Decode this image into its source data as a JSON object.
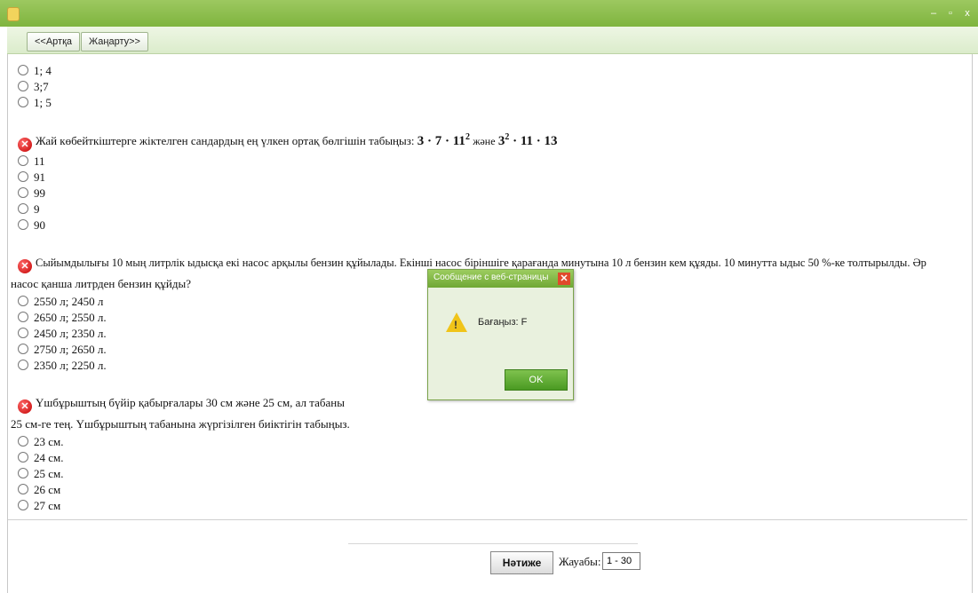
{
  "window": {
    "minimize": "–",
    "maximize": "▫",
    "close": "x"
  },
  "toolbar": {
    "back_label": "<<Артқа",
    "refresh_label": "Жаңарту>>"
  },
  "question0": {
    "options": [
      "1; 4",
      "3;7",
      "1; 5"
    ]
  },
  "question1": {
    "text": "Жай көбейткіштерге жіктелген сандардың ең үлкен ортақ бөлгішін табыңыз:",
    "formula1": "3 · 7 · 11",
    "formula1_exp": "2",
    "connector": "және",
    "formula2_base": "3",
    "formula2_exp": "2",
    "formula2_rest": " · 11 · 13",
    "options": [
      "11",
      "91",
      "99",
      "9",
      "90"
    ]
  },
  "question2": {
    "line1": "Сыйымдылығы 10 мың литрлік ыдысқа екі насос арқылы бензин құйылады. Екінші насос біріншіге қарағанда минутына 10 л бензин кем құяды. 10 минутта ыдыс 50 %-ке толтырылды. Әр",
    "line2": "насос қанша литрден бензин құйды?",
    "options": [
      "2550 л; 2450 л",
      "2650 л; 2550 л.",
      "2450 л; 2350 л.",
      "2750 л; 2650 л.",
      "2350 л; 2250 л."
    ]
  },
  "question3": {
    "line1": "Үшбұрыштың бүйір қабырғалары 30 см және 25 см, ал табаны",
    "line2": "25 см-ге тең. Үшбұрыштың табанына жүргізілген биіктігін табыңыз.",
    "options": [
      "23 см.",
      "24 см.",
      "25 см.",
      "26 см",
      "27 см"
    ]
  },
  "footer": {
    "result_button": "Нәтиже",
    "answers_label": "Жауабы:",
    "answers_value": "1 - 30"
  },
  "dialog": {
    "title": "Сообщение с веб-страницы",
    "close": "✕",
    "message": "Бағаңыз: F",
    "warn_mark": "!",
    "ok_label": "OK"
  },
  "icons": {
    "wrong": "✕"
  }
}
